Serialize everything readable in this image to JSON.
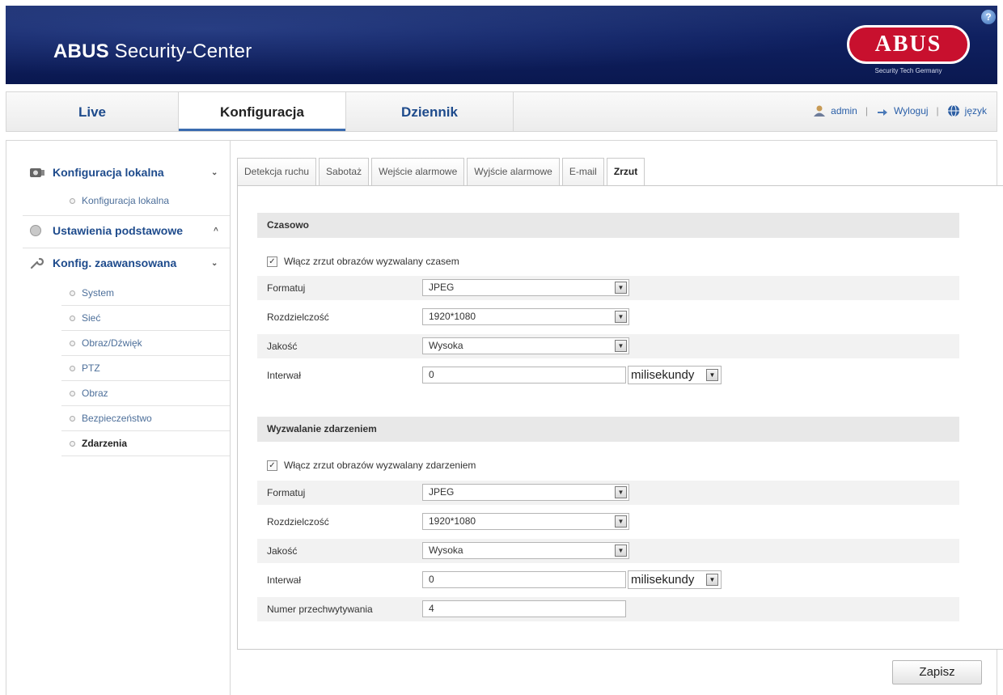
{
  "header": {
    "title_bold": "ABUS",
    "title_rest": " Security-Center",
    "logo_text": "ABUS",
    "logo_subtext": "Security Tech Germany",
    "help": "?"
  },
  "nav": {
    "tabs": [
      {
        "label": "Live"
      },
      {
        "label": "Konfiguracja"
      },
      {
        "label": "Dziennik"
      }
    ],
    "active_tab": "Konfiguracja",
    "user": "admin",
    "logout": "Wyloguj",
    "language": "język",
    "separator": "|"
  },
  "sidebar": {
    "groups": [
      {
        "label": "Konfiguracja lokalna",
        "chevron": "⌄"
      },
      {
        "label": "Ustawienia podstawowe",
        "chevron": "^"
      },
      {
        "label": "Konfig. zaawansowana",
        "chevron": "⌄"
      }
    ],
    "local_items": [
      {
        "label": "Konfiguracja lokalna"
      }
    ],
    "advanced_items": [
      {
        "label": "System"
      },
      {
        "label": "Sieć"
      },
      {
        "label": "Obraz/Dźwięk"
      },
      {
        "label": "PTZ"
      },
      {
        "label": "Obraz"
      },
      {
        "label": "Bezpieczeństwo"
      },
      {
        "label": "Zdarzenia"
      }
    ],
    "active_item": "Zdarzenia"
  },
  "subtabs": [
    {
      "label": "Detekcja ruchu"
    },
    {
      "label": "Sabotaż"
    },
    {
      "label": "Wejście alarmowe"
    },
    {
      "label": "Wyjście alarmowe"
    },
    {
      "label": "E-mail"
    },
    {
      "label": "Zrzut"
    }
  ],
  "active_subtab": "Zrzut",
  "timed": {
    "title": "Czasowo",
    "checkbox_label": "Włącz zrzut obrazów wyzwalany czasem",
    "checked": true,
    "format_label": "Formatuj",
    "format_value": "JPEG",
    "resolution_label": "Rozdzielczość",
    "resolution_value": "1920*1080",
    "quality_label": "Jakość",
    "quality_value": "Wysoka",
    "interval_label": "Interwał",
    "interval_value": "0",
    "interval_unit": "milisekundy"
  },
  "event": {
    "title": "Wyzwalanie zdarzeniem",
    "checkbox_label": "Włącz zrzut obrazów wyzwalany zdarzeniem",
    "checked": true,
    "format_label": "Formatuj",
    "format_value": "JPEG",
    "resolution_label": "Rozdzielczość",
    "resolution_value": "1920*1080",
    "quality_label": "Jakość",
    "quality_value": "Wysoka",
    "interval_label": "Interwał",
    "interval_value": "0",
    "interval_unit": "milisekundy",
    "capture_label": "Numer przechwytywania",
    "capture_value": "4"
  },
  "save_label": "Zapisz",
  "checkmark": "✓",
  "dropdown_arrow": "▼",
  "colors": {
    "header_bg": "#0f2060",
    "link": "#1e4b8c",
    "logo_red": "#c8102e",
    "section_bg": "#e8e8e8"
  }
}
